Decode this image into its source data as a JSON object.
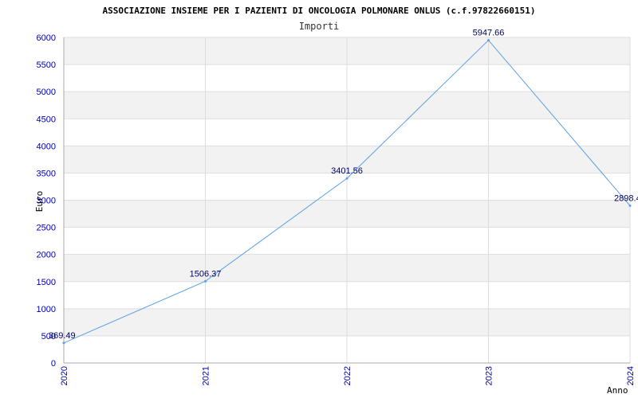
{
  "chart_data": {
    "type": "line",
    "title": "ASSOCIAZIONE INSIEME PER I PAZIENTI DI ONCOLOGIA POLMONARE ONLUS (c.f.97822660151)",
    "subtitle": "Importi",
    "xlabel": "Anno",
    "ylabel": "Euro",
    "categories": [
      "2020",
      "2021",
      "2022",
      "2023",
      "2024"
    ],
    "series": [
      {
        "values": [
          369.49,
          1506.37,
          3401.56,
          5947.66,
          2898.4
        ],
        "labels": [
          "369.49",
          "1506.37",
          "3401.56",
          "5947.66",
          "2898.4"
        ]
      }
    ],
    "ylim": [
      0,
      6000
    ],
    "yticks": [
      0,
      500,
      1000,
      1500,
      2000,
      2500,
      3000,
      3500,
      4000,
      4500,
      5000,
      5500,
      6000
    ],
    "grid": true,
    "colors": {
      "line": "#5aa0e6",
      "band": "#f2f2f2",
      "grid": "#dddddd",
      "tick_text": "#0000aa",
      "data_label": "#000066"
    }
  }
}
